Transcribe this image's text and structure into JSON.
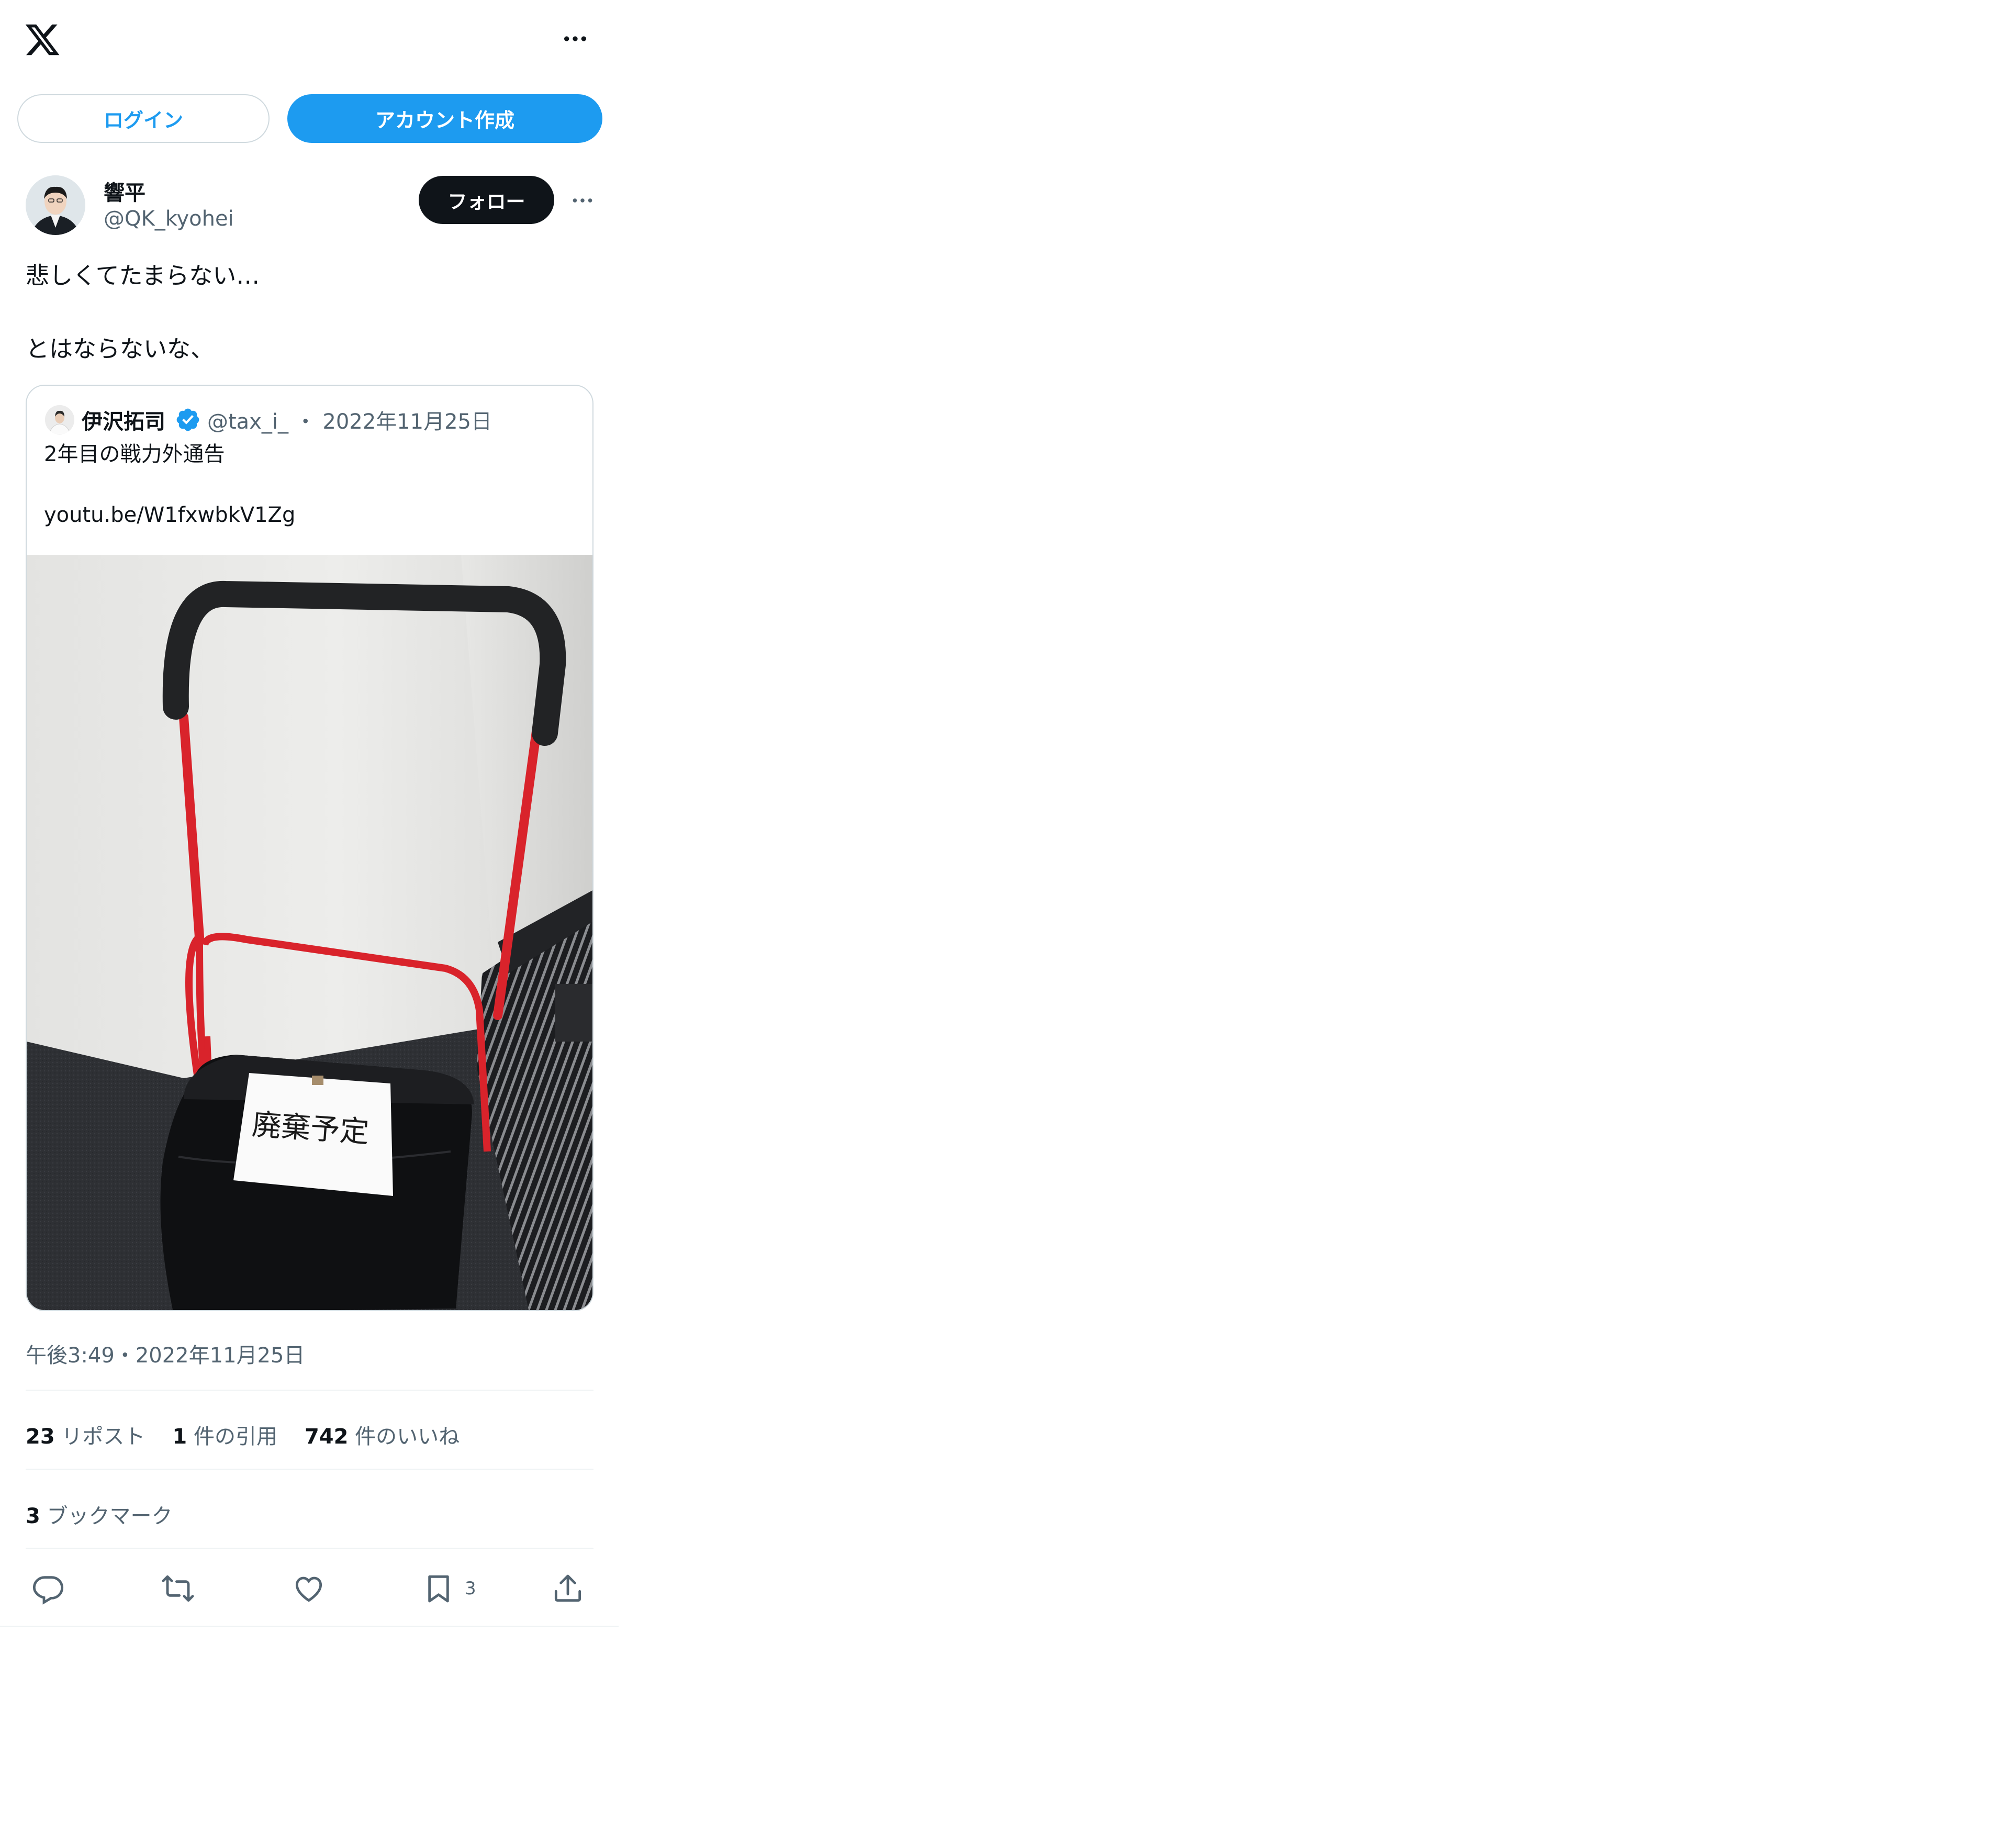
{
  "header": {
    "logo_icon": "x-logo-icon",
    "more_icon": "more-horizontal-icon"
  },
  "auth": {
    "login_label": "ログイン",
    "signup_label": "アカウント作成"
  },
  "tweet": {
    "author_name": "響平",
    "author_handle": "@QK_kyohei",
    "follow_label": "フォロー",
    "text_line1": "悲しくてたまらない…",
    "text_line2": "とはならないな、",
    "timestamp": "午後3:49・2022年11月25日"
  },
  "quote": {
    "author_name": "伊沢拓司",
    "author_handle": "@tax_i_ ・ 2022年11月25日",
    "text_line1": "2年目の戦力外通告",
    "text_line2": "youtu.be/W1fxwbkV1Zg",
    "image_sign_text": "廃棄予定",
    "verified_icon": "verified-badge-icon"
  },
  "stats": {
    "reposts_count": "23",
    "reposts_label": "リポスト",
    "quotes_count": "1",
    "quotes_label": "件の引用",
    "likes_count": "742",
    "likes_label": "件のいいね",
    "bookmarks_count": "3",
    "bookmarks_label": "ブックマーク"
  },
  "actions": {
    "bookmark_count": "3"
  },
  "colors": {
    "accent": "#1d9bf0",
    "text": "#0f1419",
    "muted": "#536471",
    "border": "#cfd9de",
    "divider": "#eff3f4"
  }
}
